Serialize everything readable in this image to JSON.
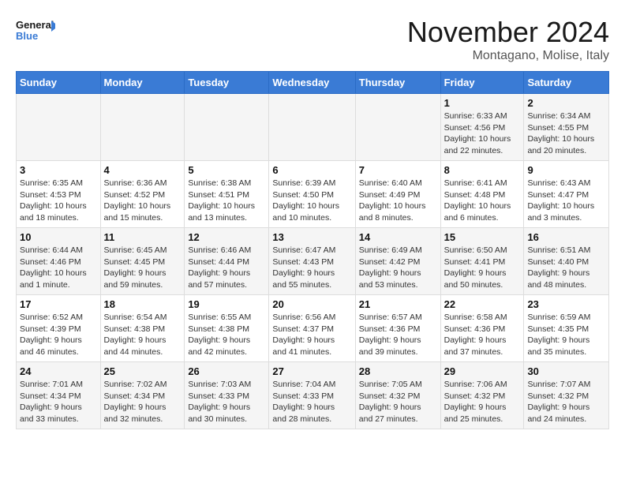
{
  "logo": {
    "line1": "General",
    "line2": "Blue"
  },
  "title": "November 2024",
  "location": "Montagano, Molise, Italy",
  "weekdays": [
    "Sunday",
    "Monday",
    "Tuesday",
    "Wednesday",
    "Thursday",
    "Friday",
    "Saturday"
  ],
  "weeks": [
    [
      {
        "day": "",
        "info": ""
      },
      {
        "day": "",
        "info": ""
      },
      {
        "day": "",
        "info": ""
      },
      {
        "day": "",
        "info": ""
      },
      {
        "day": "",
        "info": ""
      },
      {
        "day": "1",
        "info": "Sunrise: 6:33 AM\nSunset: 4:56 PM\nDaylight: 10 hours\nand 22 minutes."
      },
      {
        "day": "2",
        "info": "Sunrise: 6:34 AM\nSunset: 4:55 PM\nDaylight: 10 hours\nand 20 minutes."
      }
    ],
    [
      {
        "day": "3",
        "info": "Sunrise: 6:35 AM\nSunset: 4:53 PM\nDaylight: 10 hours\nand 18 minutes."
      },
      {
        "day": "4",
        "info": "Sunrise: 6:36 AM\nSunset: 4:52 PM\nDaylight: 10 hours\nand 15 minutes."
      },
      {
        "day": "5",
        "info": "Sunrise: 6:38 AM\nSunset: 4:51 PM\nDaylight: 10 hours\nand 13 minutes."
      },
      {
        "day": "6",
        "info": "Sunrise: 6:39 AM\nSunset: 4:50 PM\nDaylight: 10 hours\nand 10 minutes."
      },
      {
        "day": "7",
        "info": "Sunrise: 6:40 AM\nSunset: 4:49 PM\nDaylight: 10 hours\nand 8 minutes."
      },
      {
        "day": "8",
        "info": "Sunrise: 6:41 AM\nSunset: 4:48 PM\nDaylight: 10 hours\nand 6 minutes."
      },
      {
        "day": "9",
        "info": "Sunrise: 6:43 AM\nSunset: 4:47 PM\nDaylight: 10 hours\nand 3 minutes."
      }
    ],
    [
      {
        "day": "10",
        "info": "Sunrise: 6:44 AM\nSunset: 4:46 PM\nDaylight: 10 hours\nand 1 minute."
      },
      {
        "day": "11",
        "info": "Sunrise: 6:45 AM\nSunset: 4:45 PM\nDaylight: 9 hours\nand 59 minutes."
      },
      {
        "day": "12",
        "info": "Sunrise: 6:46 AM\nSunset: 4:44 PM\nDaylight: 9 hours\nand 57 minutes."
      },
      {
        "day": "13",
        "info": "Sunrise: 6:47 AM\nSunset: 4:43 PM\nDaylight: 9 hours\nand 55 minutes."
      },
      {
        "day": "14",
        "info": "Sunrise: 6:49 AM\nSunset: 4:42 PM\nDaylight: 9 hours\nand 53 minutes."
      },
      {
        "day": "15",
        "info": "Sunrise: 6:50 AM\nSunset: 4:41 PM\nDaylight: 9 hours\nand 50 minutes."
      },
      {
        "day": "16",
        "info": "Sunrise: 6:51 AM\nSunset: 4:40 PM\nDaylight: 9 hours\nand 48 minutes."
      }
    ],
    [
      {
        "day": "17",
        "info": "Sunrise: 6:52 AM\nSunset: 4:39 PM\nDaylight: 9 hours\nand 46 minutes."
      },
      {
        "day": "18",
        "info": "Sunrise: 6:54 AM\nSunset: 4:38 PM\nDaylight: 9 hours\nand 44 minutes."
      },
      {
        "day": "19",
        "info": "Sunrise: 6:55 AM\nSunset: 4:38 PM\nDaylight: 9 hours\nand 42 minutes."
      },
      {
        "day": "20",
        "info": "Sunrise: 6:56 AM\nSunset: 4:37 PM\nDaylight: 9 hours\nand 41 minutes."
      },
      {
        "day": "21",
        "info": "Sunrise: 6:57 AM\nSunset: 4:36 PM\nDaylight: 9 hours\nand 39 minutes."
      },
      {
        "day": "22",
        "info": "Sunrise: 6:58 AM\nSunset: 4:36 PM\nDaylight: 9 hours\nand 37 minutes."
      },
      {
        "day": "23",
        "info": "Sunrise: 6:59 AM\nSunset: 4:35 PM\nDaylight: 9 hours\nand 35 minutes."
      }
    ],
    [
      {
        "day": "24",
        "info": "Sunrise: 7:01 AM\nSunset: 4:34 PM\nDaylight: 9 hours\nand 33 minutes."
      },
      {
        "day": "25",
        "info": "Sunrise: 7:02 AM\nSunset: 4:34 PM\nDaylight: 9 hours\nand 32 minutes."
      },
      {
        "day": "26",
        "info": "Sunrise: 7:03 AM\nSunset: 4:33 PM\nDaylight: 9 hours\nand 30 minutes."
      },
      {
        "day": "27",
        "info": "Sunrise: 7:04 AM\nSunset: 4:33 PM\nDaylight: 9 hours\nand 28 minutes."
      },
      {
        "day": "28",
        "info": "Sunrise: 7:05 AM\nSunset: 4:32 PM\nDaylight: 9 hours\nand 27 minutes."
      },
      {
        "day": "29",
        "info": "Sunrise: 7:06 AM\nSunset: 4:32 PM\nDaylight: 9 hours\nand 25 minutes."
      },
      {
        "day": "30",
        "info": "Sunrise: 7:07 AM\nSunset: 4:32 PM\nDaylight: 9 hours\nand 24 minutes."
      }
    ]
  ]
}
